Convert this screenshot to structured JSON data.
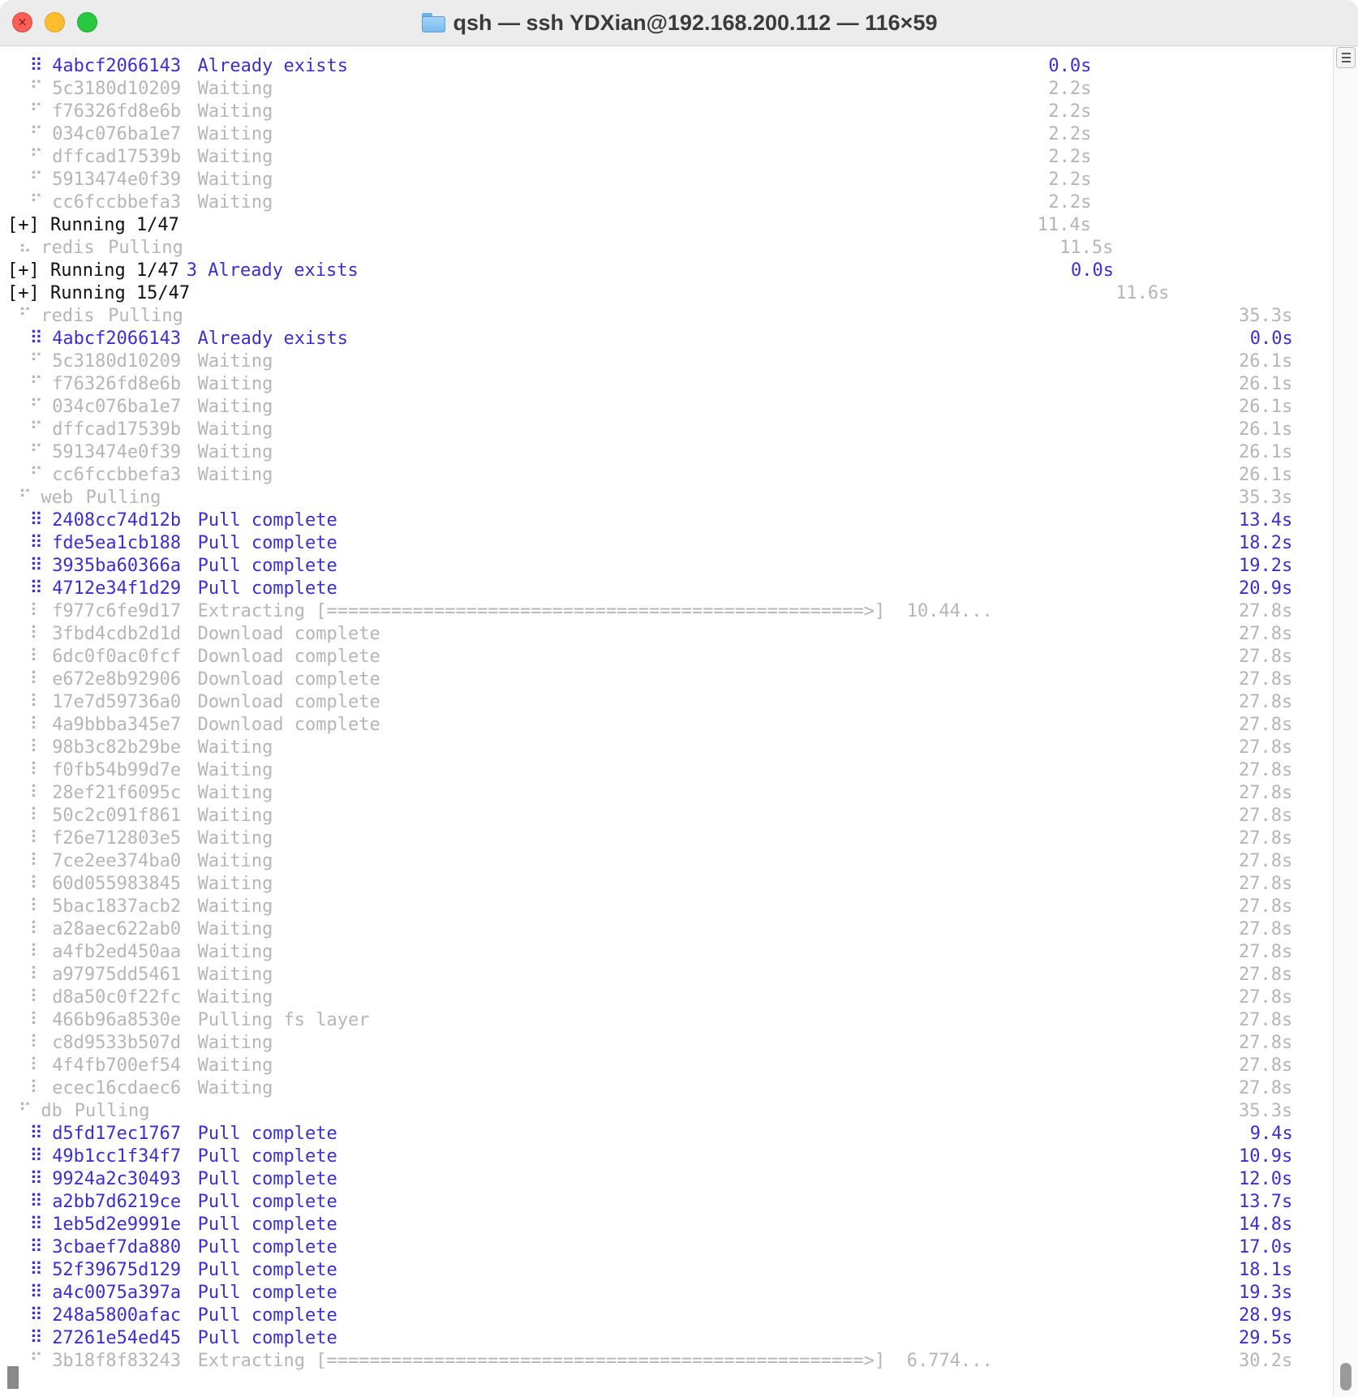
{
  "window": {
    "title": "qsh — ssh YDXian@192.168.200.112 — 116×59",
    "folder_icon": "folder-icon",
    "close_glyph": "×"
  },
  "colors": {
    "complete": "#3b2fd0",
    "pending": "#b6b6b6",
    "status": "#111111"
  },
  "terminal": {
    "lines": [
      {
        "indent": 2,
        "glyph": "⠿",
        "id": "4abcf2066143",
        "status": "Already exists",
        "time": "0.0s",
        "tc": 97,
        "color": "blue"
      },
      {
        "indent": 2,
        "glyph": "⠋",
        "id": "5c3180d10209",
        "status": "Waiting",
        "time": "2.2s",
        "tc": 97,
        "color": "gray"
      },
      {
        "indent": 2,
        "glyph": "⠋",
        "id": "f76326fd8e6b",
        "status": "Waiting",
        "time": "2.2s",
        "tc": 97,
        "color": "gray"
      },
      {
        "indent": 2,
        "glyph": "⠋",
        "id": "034c076ba1e7",
        "status": "Waiting",
        "time": "2.2s",
        "tc": 97,
        "color": "gray"
      },
      {
        "indent": 2,
        "glyph": "⠋",
        "id": "dffcad17539b",
        "status": "Waiting",
        "time": "2.2s",
        "tc": 97,
        "color": "gray"
      },
      {
        "indent": 2,
        "glyph": "⠋",
        "id": "5913474e0f39",
        "status": "Waiting",
        "time": "2.2s",
        "tc": 97,
        "color": "gray"
      },
      {
        "indent": 2,
        "glyph": "⠋",
        "id": "cc6fccbbefa3",
        "status": "Waiting",
        "time": "2.2s",
        "tc": 97,
        "color": "gray"
      },
      {
        "kind": "running",
        "text": "[+] Running 1/47",
        "time": "11.4s",
        "tc": 97
      },
      {
        "indent": 1,
        "glyph": "⠦",
        "id": "redis",
        "status": "Pulling",
        "time": "11.5s",
        "tc": 99,
        "color": "gray"
      },
      {
        "kind": "running",
        "text": "[+] Running 1/47",
        "suffix": "3 Already exists",
        "time": "0.0s",
        "tc": 99,
        "tcolor": "blue"
      },
      {
        "kind": "running",
        "text": "[+] Running 15/47",
        "time": "11.6s",
        "tc": 104
      },
      {
        "indent": 1,
        "glyph": "⠋",
        "id": "redis",
        "status": "Pulling",
        "time": "35.3s",
        "tc": 115,
        "color": "gray"
      },
      {
        "indent": 2,
        "glyph": "⠿",
        "id": "4abcf2066143",
        "status": "Already exists",
        "time": "0.0s",
        "tc": 115,
        "color": "blue"
      },
      {
        "indent": 2,
        "glyph": "⠋",
        "id": "5c3180d10209",
        "status": "Waiting",
        "time": "26.1s",
        "tc": 115,
        "color": "gray"
      },
      {
        "indent": 2,
        "glyph": "⠋",
        "id": "f76326fd8e6b",
        "status": "Waiting",
        "time": "26.1s",
        "tc": 115,
        "color": "gray"
      },
      {
        "indent": 2,
        "glyph": "⠋",
        "id": "034c076ba1e7",
        "status": "Waiting",
        "time": "26.1s",
        "tc": 115,
        "color": "gray"
      },
      {
        "indent": 2,
        "glyph": "⠋",
        "id": "dffcad17539b",
        "status": "Waiting",
        "time": "26.1s",
        "tc": 115,
        "color": "gray"
      },
      {
        "indent": 2,
        "glyph": "⠋",
        "id": "5913474e0f39",
        "status": "Waiting",
        "time": "26.1s",
        "tc": 115,
        "color": "gray"
      },
      {
        "indent": 2,
        "glyph": "⠋",
        "id": "cc6fccbbefa3",
        "status": "Waiting",
        "time": "26.1s",
        "tc": 115,
        "color": "gray"
      },
      {
        "indent": 1,
        "glyph": "⠋",
        "id": "web",
        "status": "Pulling",
        "time": "35.3s",
        "tc": 115,
        "color": "gray"
      },
      {
        "indent": 2,
        "glyph": "⠿",
        "id": "2408cc74d12b",
        "status": "Pull complete",
        "time": "13.4s",
        "tc": 115,
        "color": "blue"
      },
      {
        "indent": 2,
        "glyph": "⠿",
        "id": "fde5ea1cb188",
        "status": "Pull complete",
        "time": "18.2s",
        "tc": 115,
        "color": "blue"
      },
      {
        "indent": 2,
        "glyph": "⠿",
        "id": "3935ba60366a",
        "status": "Pull complete",
        "time": "19.2s",
        "tc": 115,
        "color": "blue"
      },
      {
        "indent": 2,
        "glyph": "⠿",
        "id": "4712e34f1d29",
        "status": "Pull complete",
        "time": "20.9s",
        "tc": 115,
        "color": "blue"
      },
      {
        "indent": 2,
        "glyph": "⠇",
        "id": "f977c6fe9d17",
        "status": "Extracting [==================================================>]  10.44...",
        "time": "27.8s",
        "tc": 115,
        "color": "gray"
      },
      {
        "indent": 2,
        "glyph": "⠇",
        "id": "3fbd4cdb2d1d",
        "status": "Download complete",
        "time": "27.8s",
        "tc": 115,
        "color": "gray"
      },
      {
        "indent": 2,
        "glyph": "⠇",
        "id": "6dc0f0ac0fcf",
        "status": "Download complete",
        "time": "27.8s",
        "tc": 115,
        "color": "gray"
      },
      {
        "indent": 2,
        "glyph": "⠇",
        "id": "e672e8b92906",
        "status": "Download complete",
        "time": "27.8s",
        "tc": 115,
        "color": "gray"
      },
      {
        "indent": 2,
        "glyph": "⠇",
        "id": "17e7d59736a0",
        "status": "Download complete",
        "time": "27.8s",
        "tc": 115,
        "color": "gray"
      },
      {
        "indent": 2,
        "glyph": "⠇",
        "id": "4a9bbba345e7",
        "status": "Download complete",
        "time": "27.8s",
        "tc": 115,
        "color": "gray"
      },
      {
        "indent": 2,
        "glyph": "⠇",
        "id": "98b3c82b29be",
        "status": "Waiting",
        "time": "27.8s",
        "tc": 115,
        "color": "gray"
      },
      {
        "indent": 2,
        "glyph": "⠇",
        "id": "f0fb54b99d7e",
        "status": "Waiting",
        "time": "27.8s",
        "tc": 115,
        "color": "gray"
      },
      {
        "indent": 2,
        "glyph": "⠇",
        "id": "28ef21f6095c",
        "status": "Waiting",
        "time": "27.8s",
        "tc": 115,
        "color": "gray"
      },
      {
        "indent": 2,
        "glyph": "⠇",
        "id": "50c2c091f861",
        "status": "Waiting",
        "time": "27.8s",
        "tc": 115,
        "color": "gray"
      },
      {
        "indent": 2,
        "glyph": "⠇",
        "id": "f26e712803e5",
        "status": "Waiting",
        "time": "27.8s",
        "tc": 115,
        "color": "gray"
      },
      {
        "indent": 2,
        "glyph": "⠇",
        "id": "7ce2ee374ba0",
        "status": "Waiting",
        "time": "27.8s",
        "tc": 115,
        "color": "gray"
      },
      {
        "indent": 2,
        "glyph": "⠇",
        "id": "60d055983845",
        "status": "Waiting",
        "time": "27.8s",
        "tc": 115,
        "color": "gray"
      },
      {
        "indent": 2,
        "glyph": "⠇",
        "id": "5bac1837acb2",
        "status": "Waiting",
        "time": "27.8s",
        "tc": 115,
        "color": "gray"
      },
      {
        "indent": 2,
        "glyph": "⠇",
        "id": "a28aec622ab0",
        "status": "Waiting",
        "time": "27.8s",
        "tc": 115,
        "color": "gray"
      },
      {
        "indent": 2,
        "glyph": "⠇",
        "id": "a4fb2ed450aa",
        "status": "Waiting",
        "time": "27.8s",
        "tc": 115,
        "color": "gray"
      },
      {
        "indent": 2,
        "glyph": "⠇",
        "id": "a97975dd5461",
        "status": "Waiting",
        "time": "27.8s",
        "tc": 115,
        "color": "gray"
      },
      {
        "indent": 2,
        "glyph": "⠇",
        "id": "d8a50c0f22fc",
        "status": "Waiting",
        "time": "27.8s",
        "tc": 115,
        "color": "gray"
      },
      {
        "indent": 2,
        "glyph": "⠇",
        "id": "466b96a8530e",
        "status": "Pulling fs layer",
        "time": "27.8s",
        "tc": 115,
        "color": "gray"
      },
      {
        "indent": 2,
        "glyph": "⠇",
        "id": "c8d9533b507d",
        "status": "Waiting",
        "time": "27.8s",
        "tc": 115,
        "color": "gray"
      },
      {
        "indent": 2,
        "glyph": "⠇",
        "id": "4f4fb700ef54",
        "status": "Waiting",
        "time": "27.8s",
        "tc": 115,
        "color": "gray"
      },
      {
        "indent": 2,
        "glyph": "⠇",
        "id": "ecec16cdaec6",
        "status": "Waiting",
        "time": "27.8s",
        "tc": 115,
        "color": "gray"
      },
      {
        "indent": 1,
        "glyph": "⠋",
        "id": "db",
        "status": "Pulling",
        "time": "35.3s",
        "tc": 115,
        "color": "gray"
      },
      {
        "indent": 2,
        "glyph": "⠿",
        "id": "d5fd17ec1767",
        "status": "Pull complete",
        "time": "9.4s",
        "tc": 115,
        "color": "blue"
      },
      {
        "indent": 2,
        "glyph": "⠿",
        "id": "49b1cc1f34f7",
        "status": "Pull complete",
        "time": "10.9s",
        "tc": 115,
        "color": "blue"
      },
      {
        "indent": 2,
        "glyph": "⠿",
        "id": "9924a2c30493",
        "status": "Pull complete",
        "time": "12.0s",
        "tc": 115,
        "color": "blue"
      },
      {
        "indent": 2,
        "glyph": "⠿",
        "id": "a2bb7d6219ce",
        "status": "Pull complete",
        "time": "13.7s",
        "tc": 115,
        "color": "blue"
      },
      {
        "indent": 2,
        "glyph": "⠿",
        "id": "1eb5d2e9991e",
        "status": "Pull complete",
        "time": "14.8s",
        "tc": 115,
        "color": "blue"
      },
      {
        "indent": 2,
        "glyph": "⠿",
        "id": "3cbaef7da880",
        "status": "Pull complete",
        "time": "17.0s",
        "tc": 115,
        "color": "blue"
      },
      {
        "indent": 2,
        "glyph": "⠿",
        "id": "52f39675d129",
        "status": "Pull complete",
        "time": "18.1s",
        "tc": 115,
        "color": "blue"
      },
      {
        "indent": 2,
        "glyph": "⠿",
        "id": "a4c0075a397a",
        "status": "Pull complete",
        "time": "19.3s",
        "tc": 115,
        "color": "blue"
      },
      {
        "indent": 2,
        "glyph": "⠿",
        "id": "248a5800afac",
        "status": "Pull complete",
        "time": "28.9s",
        "tc": 115,
        "color": "blue"
      },
      {
        "indent": 2,
        "glyph": "⠿",
        "id": "27261e54ed45",
        "status": "Pull complete",
        "time": "29.5s",
        "tc": 115,
        "color": "blue"
      },
      {
        "indent": 2,
        "glyph": "⠋",
        "id": "3b18f8f83243",
        "status": "Extracting [==================================================>]  6.774...",
        "time": "30.2s",
        "tc": 115,
        "color": "gray"
      }
    ]
  }
}
